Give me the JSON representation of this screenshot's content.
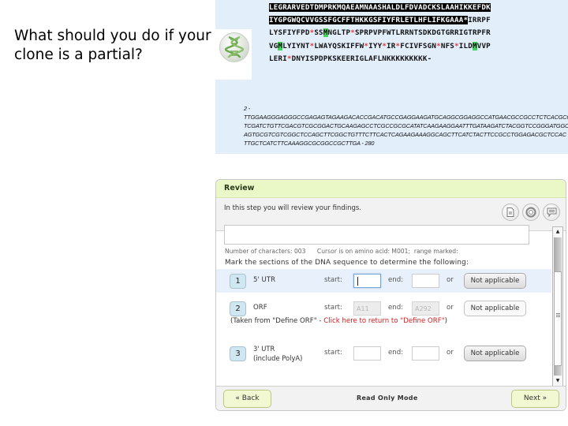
{
  "slide": {
    "question": "What should you do if your clone is a partial?"
  },
  "sequence_view": {
    "icon": "dna-helix-icon",
    "aa_lines": [
      [
        {
          "t": "LEGRARVEDTDMPRKMQAEAMNAASHALDLFDVADCKSLAAHIKKEFDK",
          "c": "hl"
        }
      ],
      [
        {
          "t": "IYGPGWQCVVGSSFGCFFTHKKGSFIYFRLETLHFLIFKGAAA",
          "c": "hl"
        },
        {
          "t": "*",
          "c": "hl"
        },
        {
          "t": "IRRPF",
          "c": ""
        }
      ],
      [
        {
          "t": "LYSFIYFPD",
          "c": ""
        },
        {
          "t": "*",
          "c": "stop"
        },
        {
          "t": "SS",
          "c": ""
        },
        {
          "t": "M",
          "c": "met"
        },
        {
          "t": "NGLTP",
          "c": ""
        },
        {
          "t": "*",
          "c": "stop"
        },
        {
          "t": "SPRPVPFWTLRRNTSDKDGTGRRIGTRPFR",
          "c": ""
        }
      ],
      [
        {
          "t": "VG",
          "c": ""
        },
        {
          "t": "M",
          "c": "met"
        },
        {
          "t": "LYIYNT",
          "c": ""
        },
        {
          "t": "*",
          "c": "stop"
        },
        {
          "t": "LWAYQSKIFFW",
          "c": ""
        },
        {
          "t": "*",
          "c": "stop"
        },
        {
          "t": "IYY",
          "c": ""
        },
        {
          "t": "*",
          "c": "stop"
        },
        {
          "t": "IR",
          "c": ""
        },
        {
          "t": "*",
          "c": "stop"
        },
        {
          "t": "FCIVFSGN",
          "c": ""
        },
        {
          "t": "*",
          "c": "stop"
        },
        {
          "t": "NFS",
          "c": ""
        },
        {
          "t": "*",
          "c": "stop"
        },
        {
          "t": "ILD",
          "c": ""
        },
        {
          "t": "M",
          "c": "met"
        },
        {
          "t": "VVP",
          "c": ""
        }
      ],
      [
        {
          "t": "LERI",
          "c": ""
        },
        {
          "t": "*",
          "c": "stop"
        },
        {
          "t": "DNYISPDPKSKEERIGLAFLNKKKKKKKKK-",
          "c": ""
        }
      ]
    ],
    "nuc_lines": [
      "2 -",
      "TTGGAAGGGAGGGCCGAGAGTAGAAGACACCGACATGCCGAGGAAGATGCAGGCGGAGGCCATGAACGCCGCCTCTCACGCGC",
      "TCGATCTGTTCGACGTCGCGGACTGCAAGAGCCTCGCCGCGCATATCAAGAAGGAATTTGATAAGATCTACGGTCCGGGATGGC",
      "AGTGCGTCGTCGGCTCCAGCTTCGGCTGTTTCTTCACTCAGAAGAAAGGCAGCTTCATCTACTTCCGCCTGGAGACGCTCCAC",
      "TTGCTCATCTTCAAAGGCGCGGCCGCTTGA - 280"
    ]
  },
  "review": {
    "title": "Review",
    "subtitle": "In this step you will review your findings.",
    "toolbar_icons": [
      "document-icon",
      "lifebuoy-help-icon",
      "comment-icon"
    ],
    "counter": "Number of characters: 003      Cursor is on amino acid: M001;  range marked:",
    "instruction": "Mark the sections of the DNA sequence to determine the following:",
    "start_label": "start:",
    "end_label": "end:",
    "or_label": "or",
    "rows": [
      {
        "num": "1",
        "label": "5' UTR",
        "start": "",
        "end": "",
        "button": "Not applicable"
      },
      {
        "num": "2",
        "label": "ORF",
        "start": "A11",
        "end": "A292",
        "button": "Not applicable"
      },
      {
        "num": "3",
        "label": "3' UTR",
        "label2": "(include PolyA)",
        "start": "",
        "end": "",
        "button": "Not applicable"
      }
    ],
    "orf_note_prefix": "(Taken from \"Define ORF\" - ",
    "orf_note_link": "Click here to return to \"Define ORF\"",
    "orf_note_suffix": ")",
    "back_label": "« Back",
    "mode_label": "Read Only Mode",
    "next_label": "Next »"
  }
}
